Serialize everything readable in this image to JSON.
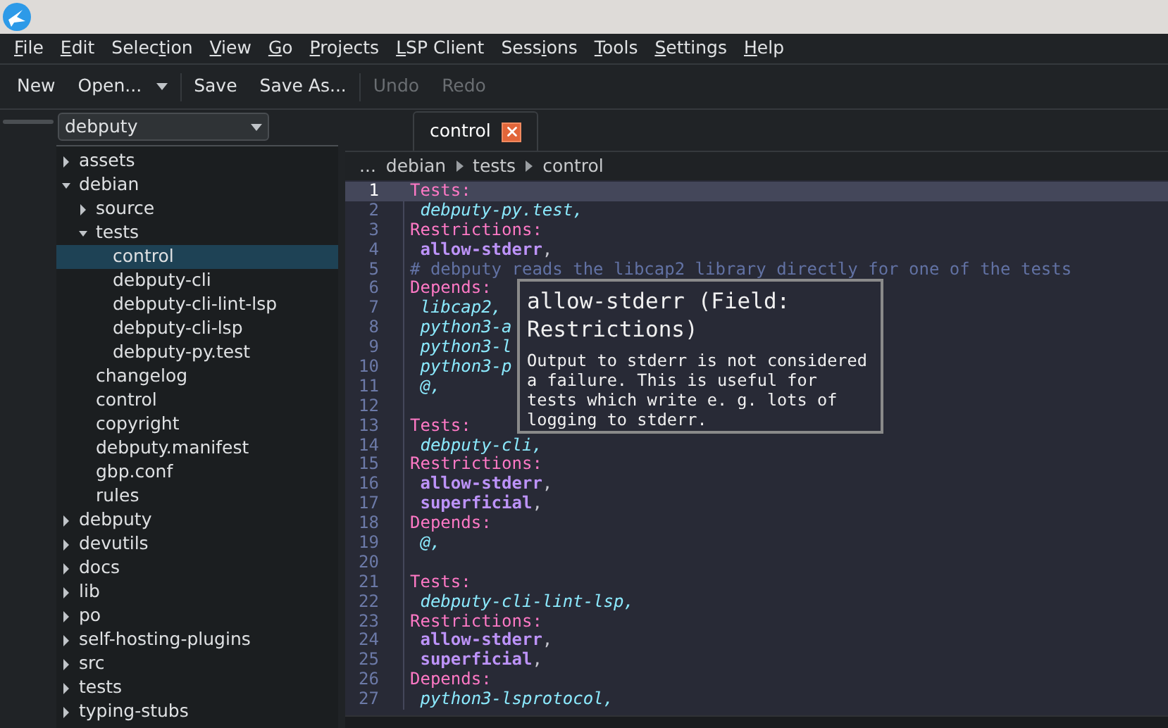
{
  "menu": [
    {
      "key": "F",
      "after": "ile"
    },
    {
      "key": "E",
      "after": "dit"
    },
    {
      "before": "Selec",
      "key": "t",
      "after": "ion"
    },
    {
      "key": "V",
      "after": "iew"
    },
    {
      "key": "G",
      "after": "o"
    },
    {
      "key": "P",
      "after": "rojects"
    },
    {
      "key": "L",
      "after": "SP Client"
    },
    {
      "before": "Sess",
      "key": "i",
      "after": "ons"
    },
    {
      "key": "T",
      "after": "ools"
    },
    {
      "key": "S",
      "after": "ettings"
    },
    {
      "key": "H",
      "after": "elp"
    }
  ],
  "toolbar": [
    {
      "kind": "button",
      "label": "New",
      "disabled": false
    },
    {
      "kind": "dropdown",
      "label": "Open...",
      "disabled": false
    },
    {
      "kind": "separator"
    },
    {
      "kind": "button",
      "label": "Save",
      "disabled": false
    },
    {
      "kind": "button",
      "label": "Save As...",
      "disabled": false
    },
    {
      "kind": "separator"
    },
    {
      "kind": "button",
      "label": "Undo",
      "disabled": true
    },
    {
      "kind": "button",
      "label": "Redo",
      "disabled": true
    }
  ],
  "project_select": {
    "value": "debputy"
  },
  "tree": [
    {
      "label": "assets",
      "kind": "folder",
      "expanded": false,
      "selected": false
    },
    {
      "label": "debian",
      "kind": "folder",
      "expanded": true,
      "selected": false,
      "children": [
        {
          "label": "source",
          "kind": "folder",
          "expanded": false,
          "selected": false
        },
        {
          "label": "tests",
          "kind": "folder",
          "expanded": true,
          "selected": false,
          "children": [
            {
              "label": "control",
              "kind": "file",
              "selected": true
            },
            {
              "label": "debputy-cli",
              "kind": "file",
              "selected": false
            },
            {
              "label": "debputy-cli-lint-lsp",
              "kind": "file",
              "selected": false
            },
            {
              "label": "debputy-cli-lsp",
              "kind": "file",
              "selected": false
            },
            {
              "label": "debputy-py.test",
              "kind": "file",
              "selected": false
            }
          ]
        },
        {
          "label": "changelog",
          "kind": "file",
          "selected": false
        },
        {
          "label": "control",
          "kind": "file",
          "selected": false
        },
        {
          "label": "copyright",
          "kind": "file",
          "selected": false
        },
        {
          "label": "debputy.manifest",
          "kind": "file",
          "selected": false
        },
        {
          "label": "gbp.conf",
          "kind": "file",
          "selected": false
        },
        {
          "label": "rules",
          "kind": "file",
          "selected": false
        }
      ]
    },
    {
      "label": "debputy",
      "kind": "folder",
      "expanded": false,
      "selected": false
    },
    {
      "label": "devutils",
      "kind": "folder",
      "expanded": false,
      "selected": false
    },
    {
      "label": "docs",
      "kind": "folder",
      "expanded": false,
      "selected": false
    },
    {
      "label": "lib",
      "kind": "folder",
      "expanded": false,
      "selected": false
    },
    {
      "label": "po",
      "kind": "folder",
      "expanded": false,
      "selected": false
    },
    {
      "label": "self-hosting-plugins",
      "kind": "folder",
      "expanded": false,
      "selected": false
    },
    {
      "label": "src",
      "kind": "folder",
      "expanded": false,
      "selected": false
    },
    {
      "label": "tests",
      "kind": "folder",
      "expanded": false,
      "selected": false
    },
    {
      "label": "typing-stubs",
      "kind": "folder",
      "expanded": false,
      "selected": false
    }
  ],
  "tabs": [
    {
      "label": "control",
      "selected": true
    }
  ],
  "breadcrumb": [
    "...",
    "debian",
    "tests",
    "control"
  ],
  "lines": [
    {
      "number": "1",
      "current": true,
      "tokens": [
        {
          "kind": "key",
          "text": "Tests:"
        }
      ]
    },
    {
      "number": "2",
      "current": false,
      "tokens": [
        {
          "kind": "value",
          "text": " debputy-py.test,"
        }
      ]
    },
    {
      "number": "3",
      "current": false,
      "tokens": [
        {
          "kind": "key",
          "text": "Restrictions:"
        }
      ]
    },
    {
      "number": "4",
      "current": false,
      "tokens": [
        {
          "kind": "bold",
          "text": " allow-stderr"
        },
        {
          "kind": "plain",
          "text": ","
        }
      ]
    },
    {
      "number": "5",
      "current": false,
      "tokens": [
        {
          "kind": "comment",
          "text": "# debputy reads the libcap2 library directly for one of the tests"
        }
      ]
    },
    {
      "number": "6",
      "current": false,
      "tokens": [
        {
          "kind": "key",
          "text": "Depends:"
        }
      ]
    },
    {
      "number": "7",
      "current": false,
      "tokens": [
        {
          "kind": "value",
          "text": " libcap2,"
        }
      ]
    },
    {
      "number": "8",
      "current": false,
      "tokens": [
        {
          "kind": "value",
          "text": " python3-a"
        }
      ]
    },
    {
      "number": "9",
      "current": false,
      "tokens": [
        {
          "kind": "value",
          "text": " python3-l"
        }
      ]
    },
    {
      "number": "10",
      "current": false,
      "tokens": [
        {
          "kind": "value",
          "text": " python3-p"
        }
      ]
    },
    {
      "number": "11",
      "current": false,
      "tokens": [
        {
          "kind": "value",
          "text": " @,"
        }
      ]
    },
    {
      "number": "12",
      "current": false
    },
    {
      "number": "13",
      "current": false,
      "tokens": [
        {
          "kind": "key",
          "text": "Tests:"
        }
      ]
    },
    {
      "number": "14",
      "current": false,
      "tokens": [
        {
          "kind": "value",
          "text": " debputy-cli,"
        }
      ]
    },
    {
      "number": "15",
      "current": false,
      "tokens": [
        {
          "kind": "key",
          "text": "Restrictions:"
        }
      ]
    },
    {
      "number": "16",
      "current": false,
      "tokens": [
        {
          "kind": "bold",
          "text": " allow-stderr"
        },
        {
          "kind": "plain",
          "text": ","
        }
      ]
    },
    {
      "number": "17",
      "current": false,
      "tokens": [
        {
          "kind": "bold",
          "text": " superficial"
        },
        {
          "kind": "plain",
          "text": ","
        }
      ]
    },
    {
      "number": "18",
      "current": false,
      "tokens": [
        {
          "kind": "key",
          "text": "Depends:"
        }
      ]
    },
    {
      "number": "19",
      "current": false,
      "tokens": [
        {
          "kind": "value",
          "text": " @,"
        }
      ]
    },
    {
      "number": "20",
      "current": false
    },
    {
      "number": "21",
      "current": false,
      "tokens": [
        {
          "kind": "key",
          "text": "Tests:"
        }
      ]
    },
    {
      "number": "22",
      "current": false,
      "tokens": [
        {
          "kind": "value",
          "text": " debputy-cli-lint-lsp,"
        }
      ]
    },
    {
      "number": "23",
      "current": false,
      "tokens": [
        {
          "kind": "key",
          "text": "Restrictions:"
        }
      ]
    },
    {
      "number": "24",
      "current": false,
      "tokens": [
        {
          "kind": "bold",
          "text": " allow-stderr"
        },
        {
          "kind": "plain",
          "text": ","
        }
      ]
    },
    {
      "number": "25",
      "current": false,
      "tokens": [
        {
          "kind": "bold",
          "text": " superficial"
        },
        {
          "kind": "plain",
          "text": ","
        }
      ]
    },
    {
      "number": "26",
      "current": false,
      "tokens": [
        {
          "kind": "key",
          "text": "Depends:"
        }
      ]
    },
    {
      "number": "27",
      "current": false,
      "tokens": [
        {
          "kind": "value",
          "text": " python3-lsprotocol,"
        }
      ]
    }
  ],
  "tooltip": {
    "title": "allow-stderr (Field: Restrictions)",
    "body": "Output to stderr is not considered a failure. This is useful for tests which write e. g. lots of logging to stderr."
  }
}
